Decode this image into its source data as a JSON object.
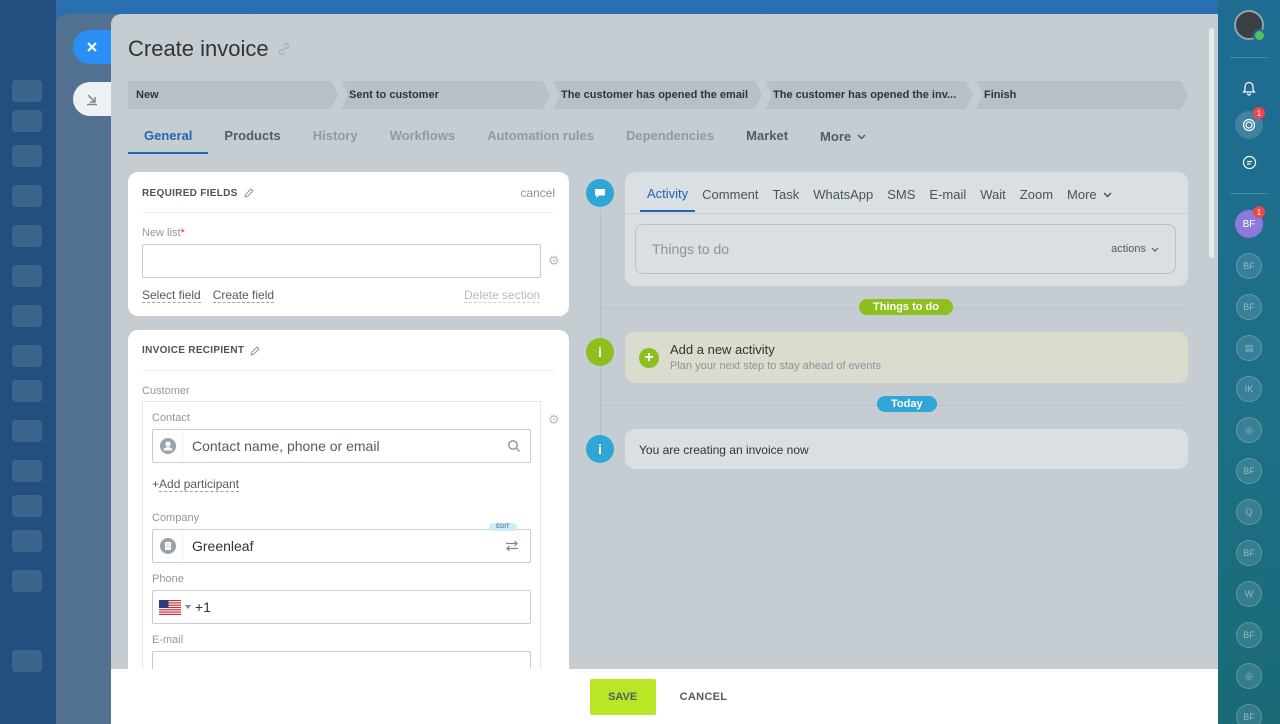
{
  "window": {
    "title": "Create invoice"
  },
  "stages": [
    "New",
    "Sent to customer",
    "The customer has opened the email",
    "The customer has opened the inv...",
    "Finish"
  ],
  "tabs": [
    "General",
    "Products",
    "History",
    "Workflows",
    "Automation rules",
    "Dependencies",
    "Market",
    "More"
  ],
  "required_section": {
    "title": "REQUIRED FIELDS",
    "cancel": "cancel",
    "field_label": "New list",
    "field_value": "",
    "select_field": "Select field",
    "create_field": "Create field",
    "delete_section": "Delete section"
  },
  "recipient": {
    "title": "INVOICE RECIPIENT",
    "customer_label": "Customer",
    "contact_label": "Contact",
    "contact_placeholder": "Contact name, phone or email",
    "add_participant": "Add participant",
    "company_label": "Company",
    "company_edit": "EDIT",
    "company_value": "Greenleaf",
    "phone_label": "Phone",
    "phone_code": "+1",
    "email_label": "E-mail",
    "email_value": ""
  },
  "activity": {
    "tabs": [
      "Activity",
      "Comment",
      "Task",
      "WhatsApp",
      "SMS",
      "E-mail",
      "Wait",
      "Zoom",
      "More"
    ],
    "input_placeholder": "Things to do",
    "actions_label": "actions",
    "things_to_do_pill": "Things to do",
    "add_title": "Add a new activity",
    "add_subtitle": "Plan your next step to stay ahead of events",
    "today_pill": "Today",
    "creating_note": "You are creating an invoice now"
  },
  "footer": {
    "save": "SAVE",
    "cancel": "CANCEL"
  },
  "right_bar": {
    "notification_badge": "1",
    "bf_badge": "1",
    "avatars": [
      "BF",
      "BF",
      "BF",
      "IK",
      "BF",
      "Q",
      "BF",
      "W",
      "BF",
      "BF"
    ]
  },
  "colors": {
    "accent": "#2067b0",
    "save": "#b9e626",
    "green_pill": "#8dbf1e",
    "blue_pill": "#2fa6d6"
  }
}
